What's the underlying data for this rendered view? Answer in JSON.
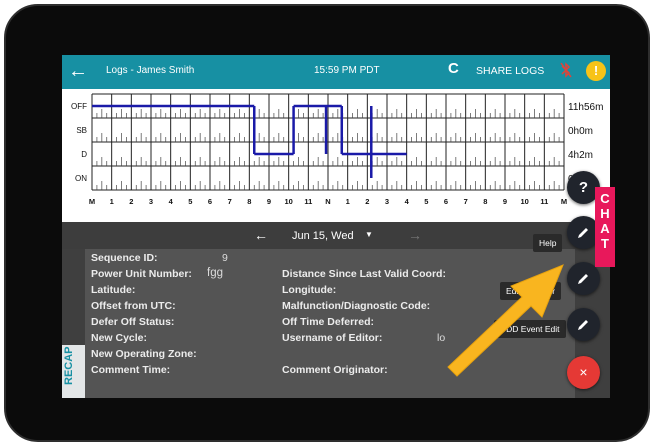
{
  "header": {
    "back_icon": "arrow-left-icon",
    "title": "Logs - James Smith",
    "time": "15:59 PM PDT",
    "refresh_glyph": "C",
    "share_label": "SHARE LOGS",
    "bluetooth_icon": "bluetooth-off-icon",
    "alert_glyph": "!"
  },
  "chart": {
    "status_rows": [
      "OFF",
      "SB",
      "D",
      "ON"
    ],
    "totals": [
      "11h56m",
      "0h0m",
      "4h2m",
      "0h2m"
    ],
    "hour_labels": [
      "M",
      "1",
      "2",
      "3",
      "4",
      "5",
      "6",
      "7",
      "8",
      "9",
      "10",
      "11",
      "N",
      "1",
      "2",
      "3",
      "4",
      "5",
      "6",
      "7",
      "8",
      "9",
      "10",
      "11",
      "M"
    ],
    "segments": [
      {
        "row": 0,
        "start": 0,
        "end": 8.25
      },
      {
        "row": 2,
        "start": 8.25,
        "end": 10.25
      },
      {
        "row": 0,
        "start": 10.25,
        "end": 12.7
      },
      {
        "row": 2,
        "start": 12.7,
        "end": 14.2
      },
      {
        "row": 3,
        "start": 14.2,
        "end": 14.2
      },
      {
        "row": 2,
        "start": 14.2,
        "end": 16.0
      }
    ],
    "spikes": [
      {
        "hour": 8.25,
        "from": 0,
        "to": 2
      },
      {
        "hour": 10.25,
        "from": 0,
        "to": 2
      },
      {
        "hour": 11.9,
        "from": 0,
        "to": 2
      },
      {
        "hour": 12.7,
        "from": 0,
        "to": 2
      },
      {
        "hour": 14.2,
        "from": 0,
        "to": 3
      }
    ],
    "line_color": "#1a1aa8"
  },
  "date_nav": {
    "prev_icon": "arrow-left-icon",
    "date": "Jun 15, Wed",
    "caret_icon": "caret-down-icon",
    "next_icon": "arrow-right-icon"
  },
  "details": {
    "sequence_id_label": "Sequence ID:",
    "sequence_id_value": "9",
    "power_unit_label": "Power Unit Number:",
    "power_unit_value": "fgg",
    "distance_label": "Distance Since Last Valid Coord:",
    "latitude_label": "Latitude:",
    "longitude_label": "Longitude:",
    "offset_label": "Offset from UTC:",
    "malfunction_label": "Malfunction/Diagnostic Code:",
    "defer_label": "Defer Off Status:",
    "off_time_label": "Off Time Deferred:",
    "new_cycle_label": "New Cycle:",
    "editor_label": "Username of Editor:",
    "editor_value_partial": "lo",
    "operating_zone_label": "New Operating Zone:",
    "comment_time_label": "Comment Time:",
    "comment_originator_label": "Comment Originator:"
  },
  "recap_label": "RECAP",
  "fab_menu": {
    "help_glyph": "?",
    "help_tooltip": "Help",
    "edit_codriver_tooltip": "Edit Codriver",
    "udd_tooltip": "UDD Event Edit",
    "close_glyph": "×",
    "edit_icon": "pencil-icon"
  },
  "chat_tab": {
    "letters": [
      "C",
      "H",
      "A",
      "T"
    ]
  },
  "colors": {
    "header": "#1790a3",
    "accent_arrow": "#f9b51f",
    "close_fab": "#e53935",
    "chat": "#e8185b"
  }
}
